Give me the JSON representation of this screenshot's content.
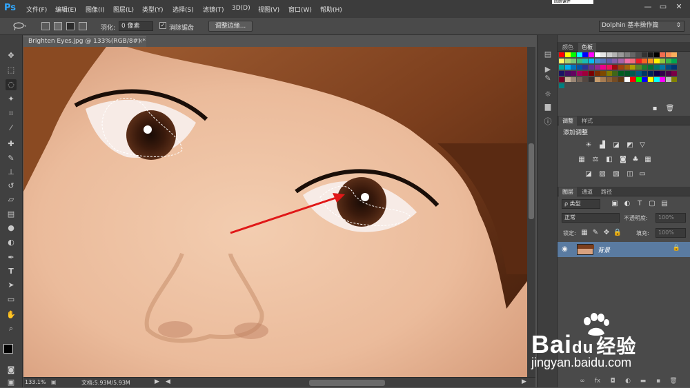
{
  "app": {
    "logo": "Ps",
    "topright_text": "回顾课件"
  },
  "menu": [
    "文件(F)",
    "编辑(E)",
    "图像(I)",
    "图层(L)",
    "类型(Y)",
    "选择(S)",
    "滤镜(T)",
    "3D(D)",
    "视图(V)",
    "窗口(W)",
    "帮助(H)"
  ],
  "window_controls": {
    "minimize": "—",
    "restore": "▭",
    "close": "✕"
  },
  "options_bar": {
    "feather_label": "羽化:",
    "feather_value": "0 像素",
    "antialias_label": "消除锯齿",
    "antialias_checked": true,
    "refine_edge_button": "调整边缘...",
    "workspace": "Dolphin 基本操作篇"
  },
  "document": {
    "tab_title": "Brighten Eyes.jpg @ 133%(RGB/8#) *",
    "close": "×",
    "zoom": "133.1%",
    "doc_info": "文档:5.93M/5.93M"
  },
  "panels": {
    "swatch_tabs": [
      "颜色",
      "色板"
    ],
    "adjust_tabs": [
      "调整",
      "样式"
    ],
    "adjust_heading": "添加调整",
    "layer_tabs": [
      "图层",
      "通道",
      "路径"
    ],
    "layer_filter": "ρ 类型",
    "blend_mode": "正常",
    "opacity_label": "不透明度:",
    "opacity_value": "100%",
    "lock_label": "锁定:",
    "fill_label": "填充:",
    "fill_value": "100%",
    "layers": [
      {
        "name": "背景",
        "visible": true,
        "locked": true
      }
    ]
  },
  "swatch_colors": [
    "#ff0000",
    "#ffff00",
    "#00ff00",
    "#00ffff",
    "#0000ff",
    "#ff00ff",
    "#ffffff",
    "#e6e6e6",
    "#cccccc",
    "#b3b3b3",
    "#999999",
    "#808080",
    "#666666",
    "#4d4d4d",
    "#333333",
    "#1a1a1a",
    "#000000",
    "#f26c4f",
    "#f68e55",
    "#fbaf5c",
    "#fff467",
    "#acd372",
    "#7cc576",
    "#3bb878",
    "#1abbb4",
    "#00bff3",
    "#438ccb",
    "#5574b9",
    "#605ca8",
    "#855fa8",
    "#a763a8",
    "#f06ea9",
    "#f26d7d",
    "#ed1c24",
    "#f26522",
    "#f7941d",
    "#fff200",
    "#8dc63f",
    "#39b54a",
    "#00a651",
    "#00a99d",
    "#00aeef",
    "#0072bc",
    "#0054a6",
    "#2e3192",
    "#662d91",
    "#92278f",
    "#ec008c",
    "#ed145b",
    "#9e0b0f",
    "#a0410d",
    "#a36209",
    "#aba000",
    "#598527",
    "#1a7b30",
    "#007236",
    "#00746b",
    "#0076a3",
    "#004b80",
    "#003471",
    "#1b1464",
    "#440e62",
    "#630460",
    "#9e005d",
    "#9e0039",
    "#790000",
    "#7b2e00",
    "#7d4900",
    "#827b00",
    "#406618",
    "#005e20",
    "#005826",
    "#005952",
    "#005b7f",
    "#003663",
    "#002157",
    "#0d004c",
    "#32004b",
    "#4b0049",
    "#7b0046",
    "#7a0026",
    "#c7b299",
    "#998675",
    "#736357",
    "#534741",
    "#37302d",
    "#c69c6d",
    "#a67c52",
    "#8c6239",
    "#754c24",
    "#603913",
    "#ffffff",
    "#ff0000",
    "#00ff00",
    "#0000ff",
    "#ffff00",
    "#00ffff",
    "#ff00ff",
    "#c0c0c0",
    "#808000",
    "#008080"
  ],
  "watermark": {
    "brand": "Bai",
    "brand_mid": "du",
    "brand_cn": "经验",
    "url": "jingyan.baidu.com"
  }
}
